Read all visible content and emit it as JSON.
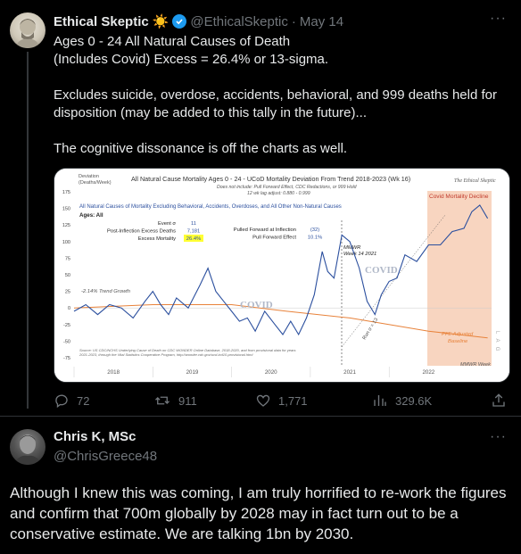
{
  "tweet1": {
    "author_name": "Ethical Skeptic",
    "author_emoji": "☀️",
    "handle": "@EthicalSkeptic",
    "separator": "·",
    "date": "May 14",
    "text_lines": [
      "Ages 0 - 24 All Natural Causes of Death",
      "(Includes Covid) Excess = 26.4% or 13-sigma."
    ],
    "text_para2": "Excludes suicide, overdose, accidents, behavioral, and 999 deaths held for disposition (may be added to this tally in the future)...",
    "text_para3": "The cognitive dissonance is off the charts as well.",
    "actions": {
      "replies": "72",
      "retweets": "911",
      "likes": "1,771",
      "views": "329.6K"
    }
  },
  "chart": {
    "title": "All Natural Cause Mortality Ages 0 - 24 - UCoD Mortality Deviation From Trend  2018-2023 (Wk 16)",
    "watermark": "The Ethical Skeptic",
    "subtitle1": "Does not include: Pull Forward Effect, CDC Redactions, or 999 Hold",
    "subtitle2": "12 wk lag adjust: 0.880 - 0.999",
    "ylabel1": "Deviation",
    "ylabel2": "(Deaths/Week)",
    "covid_decline_label": "Covid Mortality Decline",
    "header_line": "All Natural Causes of Mortality Excluding Behavioral, Accidents, Overdoses, and All Other Non-Natural Causes",
    "ages": "Ages: All",
    "stats": [
      {
        "label": "Event σ",
        "value": "11"
      },
      {
        "label": "Post-Inflection Excess Deaths",
        "value": "7,181"
      },
      {
        "label": "Excess Mortality",
        "value": "26.4%"
      }
    ],
    "stats2": [
      {
        "label": "Pulled Forward at Inflection",
        "value": "(32)"
      },
      {
        "label": "Pull Forward Effect",
        "value": "10.1%"
      }
    ],
    "mmwr_label1": "MMWR",
    "mmwr_label2": "Week 14 2021",
    "trend_label": "-2.14% Trend Growth",
    "covid1": "COVID",
    "covid2": "COVID",
    "run_label": "Run σ = 13",
    "pfe_label1": "PFE Adjusted",
    "pfe_label2": "Baseline",
    "lag_label": "L A G",
    "mmwr_week": "MMWR Week",
    "source1": "Source: US CDC/NCHS Underlying Cause of Death on CDC WONDER Online Database, 2018-2020, and from provisional data for years",
    "source2": "2021-2023, through the Vital Statistics Cooperative Program, http://wonder.cdc.gov/ucd-icd10-provisional.html",
    "colors": {
      "series": "#2b4f9e",
      "baseline": "#e8823a",
      "highlight": "#ffff33",
      "decline": "#f8d5c0"
    }
  },
  "chart_data": {
    "type": "line",
    "title": "All Natural Cause Mortality Ages 0 - 24 - UCoD Mortality Deviation From Trend  2018-2023 (Wk 16)",
    "xlabel": "MMWR Week",
    "ylabel": "Deviation (Deaths/Week)",
    "x_ticks": [
      "2018",
      "2019",
      "2020",
      "2021",
      "2022"
    ],
    "y_ticks": [
      175,
      150,
      125,
      100,
      75,
      50,
      25,
      0,
      -25,
      -50,
      -75
    ],
    "ylim": [
      -75,
      175
    ],
    "xlim": [
      2018.0,
      2023.3
    ],
    "series": [
      {
        "name": "Deviation",
        "x": [
          2018.0,
          2018.15,
          2018.3,
          2018.45,
          2018.6,
          2018.75,
          2018.9,
          2019.0,
          2019.1,
          2019.2,
          2019.3,
          2019.45,
          2019.6,
          2019.7,
          2019.8,
          2019.9,
          2020.0,
          2020.1,
          2020.2,
          2020.3,
          2020.42,
          2020.55,
          2020.65,
          2020.75,
          2020.85,
          2020.95,
          2021.05,
          2021.15,
          2021.22,
          2021.3,
          2021.4,
          2021.5,
          2021.62,
          2021.72,
          2021.82,
          2021.9,
          2022.0,
          2022.1,
          2022.2,
          2022.35,
          2022.5,
          2022.65,
          2022.8,
          2022.95,
          2023.05,
          2023.15,
          2023.25
        ],
        "y": [
          -5,
          5,
          -10,
          5,
          0,
          -15,
          10,
          25,
          5,
          -10,
          15,
          0,
          35,
          60,
          25,
          10,
          -5,
          -20,
          -15,
          -35,
          -5,
          -25,
          -40,
          -20,
          -40,
          -15,
          20,
          85,
          55,
          45,
          110,
          100,
          60,
          10,
          -10,
          20,
          40,
          45,
          80,
          70,
          95,
          95,
          115,
          120,
          145,
          155,
          135
        ]
      },
      {
        "name": "PFE Adjusted Baseline",
        "x": [
          2018.0,
          2019.0,
          2020.0,
          2020.7,
          2021.5,
          2022.5,
          2023.25
        ],
        "y": [
          0,
          5,
          5,
          -5,
          -15,
          -35,
          -45
        ]
      }
    ]
  },
  "tweet2": {
    "author_name": "Chris K, MSc",
    "handle": "@ChrisGreece48",
    "text": "Although I knew this was coming, I am truly horrified to re-work the figures and confirm that 700m globally by 2028 may in fact turn out to be a conservative estimate. We are talking 1bn by 2030."
  }
}
